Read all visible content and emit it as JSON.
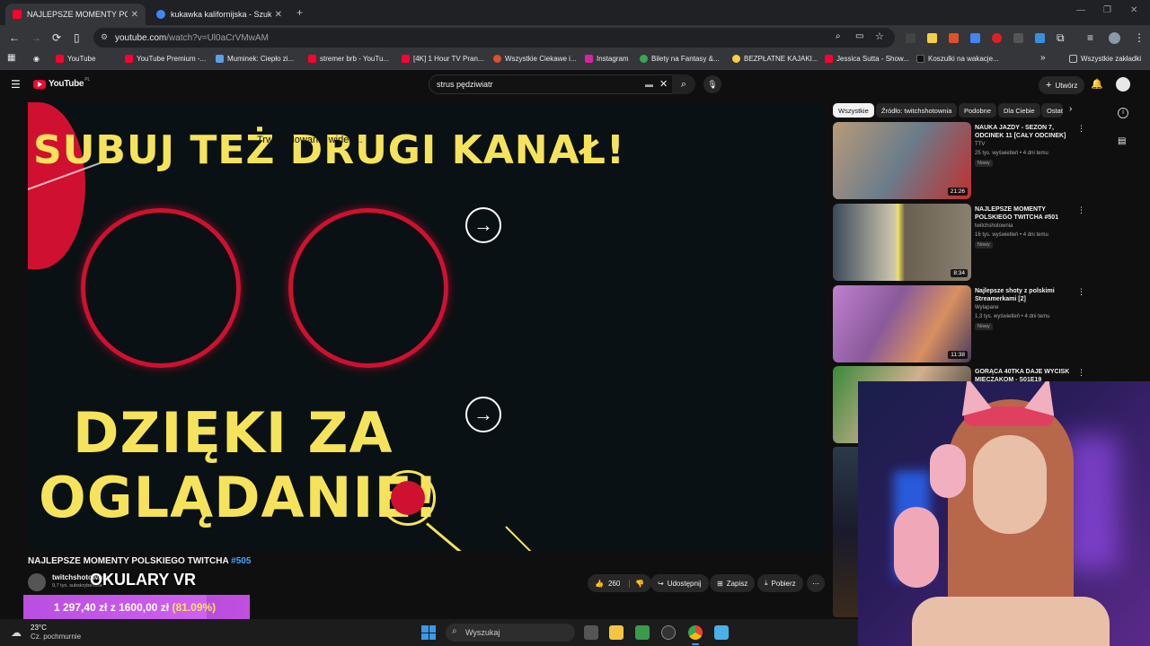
{
  "browser": {
    "tabs": [
      {
        "title": "NAJLEPSZE MOMENTY POLSKIEGO",
        "active": true,
        "favicon_color": "#ff0033"
      },
      {
        "title": "kukawka kalifornijska - Szukaj w",
        "active": false,
        "favicon_color": "#4285f4"
      }
    ],
    "new_tab": "+",
    "url_host": "youtube.com",
    "url_path": "/watch?v=Ul0aCrVMwAM",
    "bookmarks": [
      {
        "label": "YouTube",
        "color": "#ff0033"
      },
      {
        "label": "YouTube Premium -...",
        "color": "#ff0033"
      },
      {
        "label": "Muminek: Ciepło zi...",
        "color": "#5aa0e6"
      },
      {
        "label": "stremer brb - YouTu...",
        "color": "#ff0033"
      },
      {
        "label": "[4K] 1 Hour TV Pran...",
        "color": "#ff0033"
      },
      {
        "label": "Wszystkie Ciekawe i...",
        "color": "#e0502a"
      },
      {
        "label": "Instagram",
        "color": "#d6249f"
      },
      {
        "label": "Bilety na Fantasy &...",
        "color": "#34a853"
      },
      {
        "label": "BEZPŁATNE KAJAKI...",
        "color": "#f5d042"
      },
      {
        "label": "Jessica Sutta - Show...",
        "color": "#ff0033"
      },
      {
        "label": "Koszulki na wakacje...",
        "color": "#111111"
      }
    ],
    "all_bookmarks": "Wszystkie zakładki"
  },
  "youtube": {
    "logo": "YouTube",
    "logo_country": "PL",
    "search_value": "strus pędziwiatr",
    "create_label": "Utwórz",
    "video": {
      "screen_line1": "SUBUJ TEŻ DRUGI KANAŁ!",
      "screen_overlay": "Trwa ładowanie wideo...",
      "screen_line2": "DZIĘKI ZA",
      "screen_line3": "OGLĄDANIE!"
    },
    "title": "NAJLEPSZE MOMENTY POLSKIEGO TWITCHA",
    "title_number": "#505",
    "channel": "twitchshotownia",
    "subscribers": "9,7 tys. subskrybentów",
    "overlay_text": "OKULARY VR",
    "likes": "260",
    "share": "Udostępnij",
    "save": "Zapisz",
    "download": "Pobierz",
    "chips": [
      {
        "label": "Wszystkie",
        "active": true
      },
      {
        "label": "Źródło: twitchshotownia",
        "active": false
      },
      {
        "label": "Podobne",
        "active": false
      },
      {
        "label": "Dla Ciebie",
        "active": false
      },
      {
        "label": "Ostat",
        "active": false
      }
    ],
    "recommendations": [
      {
        "title": "NAUKA JAZDY - SEZON 7, ODCINEK 11 [CAŁY ODCINEK]",
        "channel": "TTV",
        "meta": "25 tys. wyświetleń • 4 dni temu",
        "badge": "Nowy",
        "duration": "21:26"
      },
      {
        "title": "NAJLEPSZE MOMENTY POLSKIEGO TWITCHA #501",
        "channel": "twitchshotownia",
        "meta": "16 tys. wyświetleń • 4 dni temu",
        "badge": "Nowy",
        "duration": "8:34"
      },
      {
        "title": "Najlepsze shoty z polskimi Streamerkami [2]",
        "channel": "Wylapane",
        "meta": "1,3 tys. wyświetleń • 4 dni temu",
        "badge": "Nowy",
        "duration": "11:38"
      },
      {
        "title": "GORĄCA 40TKA DAJE WYCISK MIECZAKOM - S01E19",
        "channel": "",
        "meta": "",
        "badge": "",
        "duration": ""
      }
    ]
  },
  "donation": {
    "current": "1 297,40 zł",
    "separator": "z",
    "goal": "1600,00 zł",
    "percent_text": "(81.09%)",
    "percent": 0.8109
  },
  "taskbar": {
    "weather_temp": "23°C",
    "weather_desc": "Cz. pochmurnie",
    "search": "Wyszukaj"
  }
}
